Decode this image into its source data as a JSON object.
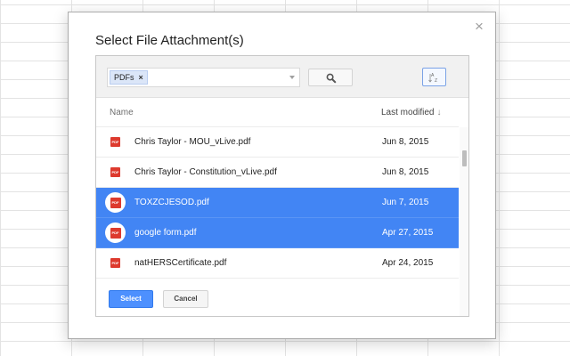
{
  "dialog": {
    "title": "Select File Attachment(s)",
    "close_icon": "close-icon",
    "close_glyph": "×"
  },
  "toolbar": {
    "filter_chip": "PDFs",
    "chip_remove_glyph": "×",
    "search_icon": "search-icon",
    "sort_icon": "sort-az-icon",
    "dropdown_icon": "chevron-down-icon"
  },
  "columns": {
    "name": "Name",
    "modified": "Last modified",
    "sort_arrow": "↓"
  },
  "files": [
    {
      "name": "Chris Taylor - MOU_vLive.pdf",
      "date": "Jun 8, 2015",
      "selected": false
    },
    {
      "name": "Chris Taylor - Constitution_vLive.pdf",
      "date": "Jun 8, 2015",
      "selected": false
    },
    {
      "name": "TOXZCJESOD.pdf",
      "date": "Jun 7, 2015",
      "selected": true
    },
    {
      "name": "google form.pdf",
      "date": "Apr 27, 2015",
      "selected": true
    },
    {
      "name": "natHERSCertificate.pdf",
      "date": "Apr 24, 2015",
      "selected": false
    }
  ],
  "buttons": {
    "select": "Select",
    "cancel": "Cancel"
  },
  "colors": {
    "selection": "#4285f4",
    "pdf_red": "#dd3a2e",
    "primary_button": "#4d90fe"
  }
}
